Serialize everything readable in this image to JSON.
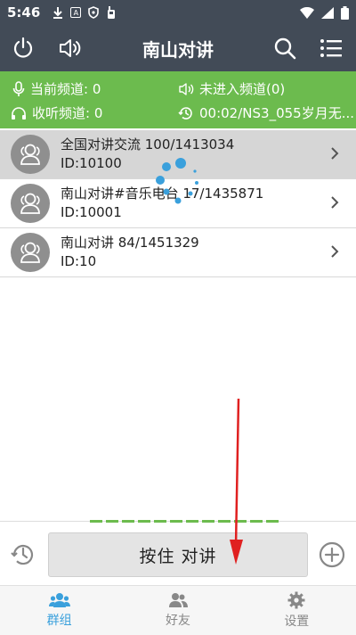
{
  "status_bar": {
    "time": "5:46",
    "icons": [
      "download-icon",
      "a-box-icon",
      "shield-icon",
      "walkie-talkie-icon"
    ],
    "right_icons": [
      "wifi-icon",
      "signal-icon",
      "battery-icon"
    ]
  },
  "app_bar": {
    "title": "南山对讲",
    "left_icons": [
      "power-icon",
      "speaker-icon"
    ],
    "right_icons": [
      "search-icon",
      "menu-list-icon"
    ]
  },
  "info": {
    "current_channel": "当前频道: 0",
    "listen_channel": "收听频道: 0",
    "not_entered": "未进入频道(0)",
    "history": "00:02/NS3_055岁月无..."
  },
  "channels": [
    {
      "title": "全国对讲交流 100/1413034",
      "id": "ID:10100"
    },
    {
      "title": "南山对讲#音乐电台 17/1435871",
      "id": "ID:10001"
    },
    {
      "title": "南山对讲 84/1451329",
      "id": "ID:10"
    }
  ],
  "ptt": {
    "label": "按住 对讲"
  },
  "tabs": [
    {
      "label": "群组",
      "icon": "group-icon"
    },
    {
      "label": "好友",
      "icon": "friends-icon"
    },
    {
      "label": "设置",
      "icon": "gear-icon"
    }
  ],
  "colors": {
    "header": "#424b57",
    "info": "#6cbb4e",
    "accent": "#3aa0dc",
    "annotation": "#e02020"
  }
}
